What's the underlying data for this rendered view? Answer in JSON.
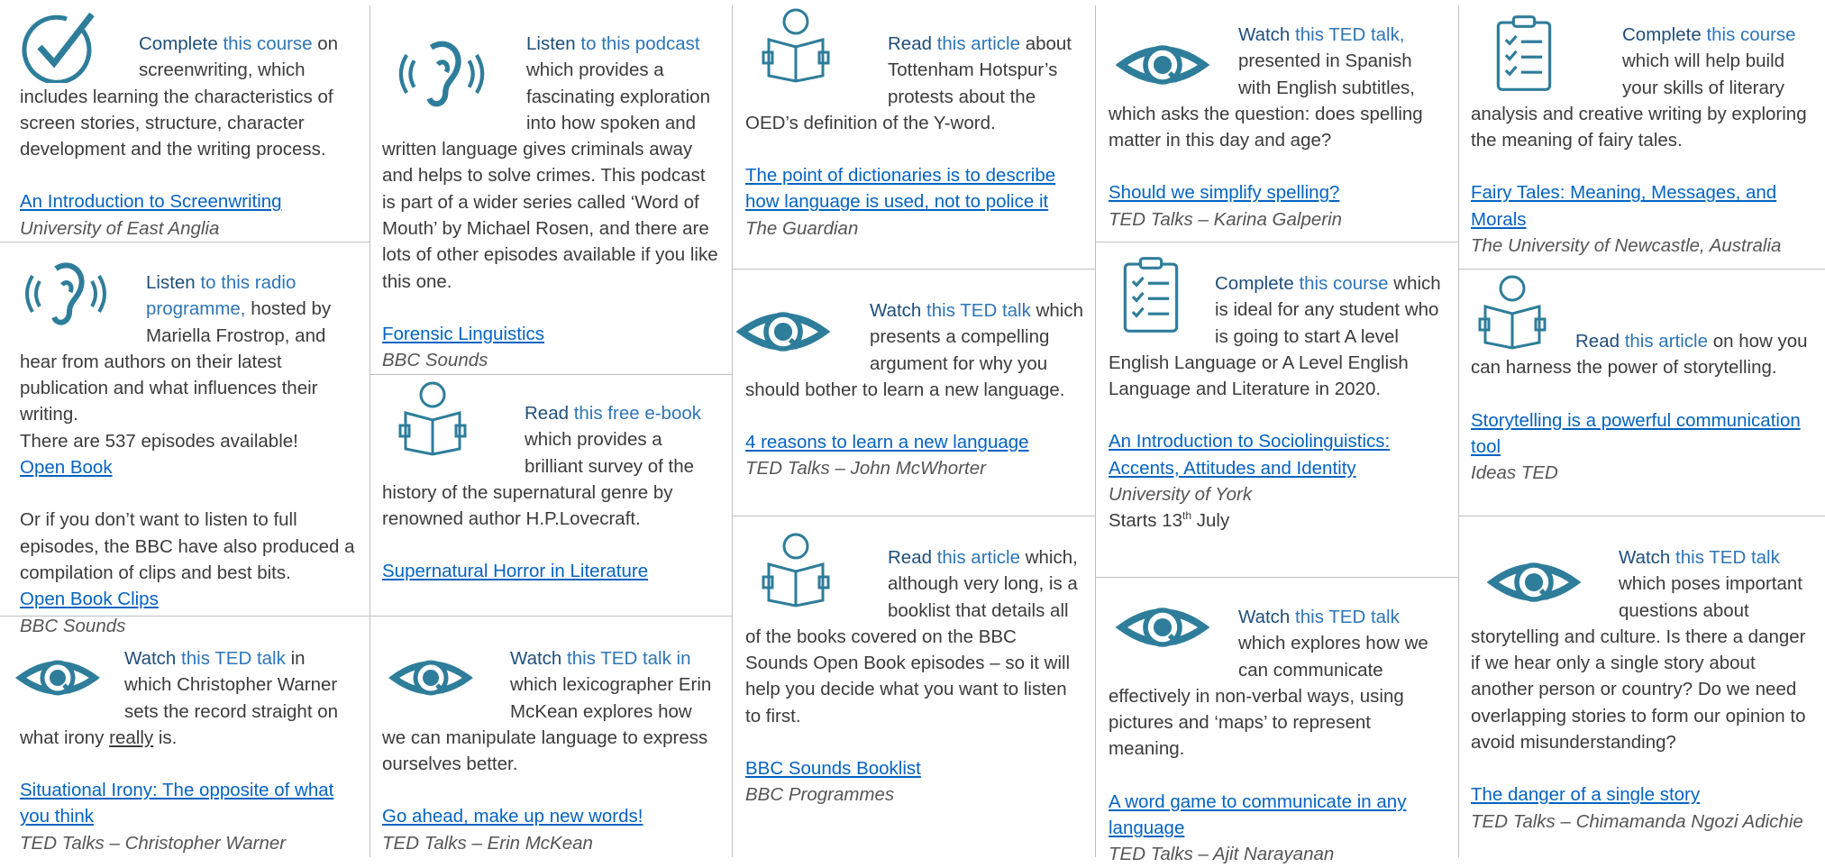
{
  "cards": [
    {
      "verb": "Complete",
      "rest": " this course",
      "body": " on screenwriting, which includes learning the characteristics of screen stories, structure, character development and the writing process.",
      "link": "An Introduction to Screenwriting",
      "source": "University of East Anglia",
      "icon": "checkmark-circle-icon"
    },
    {
      "verb": "Listen",
      "rest": " to this radio programme,",
      "body": " hosted by Mariella Frostrop, and hear from authors on their latest publication and what influences their writing.",
      "extra": "There are 537 episodes available!",
      "link": "Open Book",
      "extra2": "Or if you don’t want to listen to full episodes, the BBC have also produced a compilation of clips and best bits.",
      "link2": "Open Book Clips",
      "source": "BBC Sounds",
      "icon": "ear-icon"
    },
    {
      "verb": "Watch",
      "rest": " this TED talk",
      "body_a": " in which Christopher Warner sets the record straight on what irony ",
      "body_u": "really",
      "body_b": " is.",
      "link": "Situational Irony: The opposite of what you think",
      "source": "TED Talks – Christopher Warner",
      "icon": "eye-icon"
    },
    {
      "verb": "Listen",
      "rest": " to this podcast",
      "body": " which provides a fascinating exploration into how spoken and written language gives criminals away and helps to solve crimes. This podcast is part of a wider series called ‘Word of Mouth’ by Michael Rosen, and there are lots of other episodes available if you like this one.",
      "link": "Forensic Linguistics",
      "source": "BBC Sounds",
      "icon": "ear-icon"
    },
    {
      "verb": "Read",
      "rest": " this free e-book",
      "body": " which provides a brilliant survey of the history of the supernatural genre by renowned author H.P.Lovecraft.",
      "link": "Supernatural Horror in Literature",
      "icon": "reader-icon"
    },
    {
      "verb": "Watch",
      "rest": " this TED talk in",
      "body": " which lexicographer Erin McKean explores how we can manipulate language to express ourselves better.",
      "link": "Go ahead, make up new words!",
      "source": "TED Talks – Erin McKean",
      "icon": "eye-icon"
    },
    {
      "verb": "Read",
      "rest": " this article",
      "body": " about Tottenham Hotspur’s protests about the OED’s definition of the Y-word.",
      "link": "The point of dictionaries is to describe how language is used, not to police it",
      "source": "The Guardian",
      "icon": "reader-icon"
    },
    {
      "verb": "Watch",
      "rest": " this TED talk",
      "body": " which presents a compelling argument for why you should bother to learn a new language.",
      "link": "4 reasons to learn a new language",
      "source": "TED Talks – John McWhorter",
      "icon": "eye-icon"
    },
    {
      "verb": "Read",
      "rest": " this article",
      "body": " which, although very long, is a booklist that details all of the books covered on the BBC Sounds Open Book episodes – so it will help you decide what you want to listen to first.",
      "link": "BBC Sounds Booklist",
      "source": "BBC Programmes",
      "icon": "reader-icon"
    },
    {
      "verb": "Watch",
      "rest": " this TED talk,",
      "body": " presented in Spanish with English subtitles, which asks the question: does spelling matter in this day and age?",
      "link": "Should we simplify spelling?",
      "source": "TED Talks – Karina Galperin",
      "icon": "eye-icon"
    },
    {
      "verb": "Complete",
      "rest": " this course",
      "body": " which is ideal for any student who is going to start A level English Language or A Level English Language and Literature in 2020.",
      "link": "An Introduction to Sociolinguistics: Accents, Attitudes and Identity",
      "source": "University of York",
      "starts": "Starts 13",
      "sup": "th",
      "starts_end": " July",
      "icon": "checklist-icon"
    },
    {
      "verb": "Watch",
      "rest": " this TED talk",
      "body": " which explores how we can communicate effectively in non-verbal ways, using pictures and ‘maps’ to represent meaning.",
      "link": "A word game to communicate in any language",
      "source": "TED Talks – Ajit Narayanan",
      "icon": "eye-icon"
    },
    {
      "verb": "Complete",
      "rest": " this course",
      "body": " which will help build your skills of literary analysis and creative writing by exploring the meaning of fairy tales.",
      "link": "Fairy Tales: Meaning, Messages, and Morals",
      "source": "The University of Newcastle, Australia",
      "icon": "checklist-icon"
    },
    {
      "verb": "Read",
      "rest": " this article",
      "body": " on how you can harness the power of storytelling.",
      "link": "Storytelling is a powerful communication tool",
      "source": "Ideas TED",
      "icon": "reader-icon"
    },
    {
      "verb": "Watch",
      "rest": " this TED talk",
      "body": " which poses important questions about storytelling and culture. Is there a danger if we hear only a single story about another person or country? Do we need overlapping stories to form our opinion to avoid misunderstanding?",
      "link": "The danger of a single story",
      "source": "TED Talks – Chimamanda Ngozi Adichie",
      "icon": "eye-icon"
    }
  ],
  "colors": {
    "icon": "#2e7d9a",
    "verb": "#1f4e79",
    "accent": "#2e75b6",
    "link": "#0563c1",
    "rule": "#bfbfbf"
  }
}
